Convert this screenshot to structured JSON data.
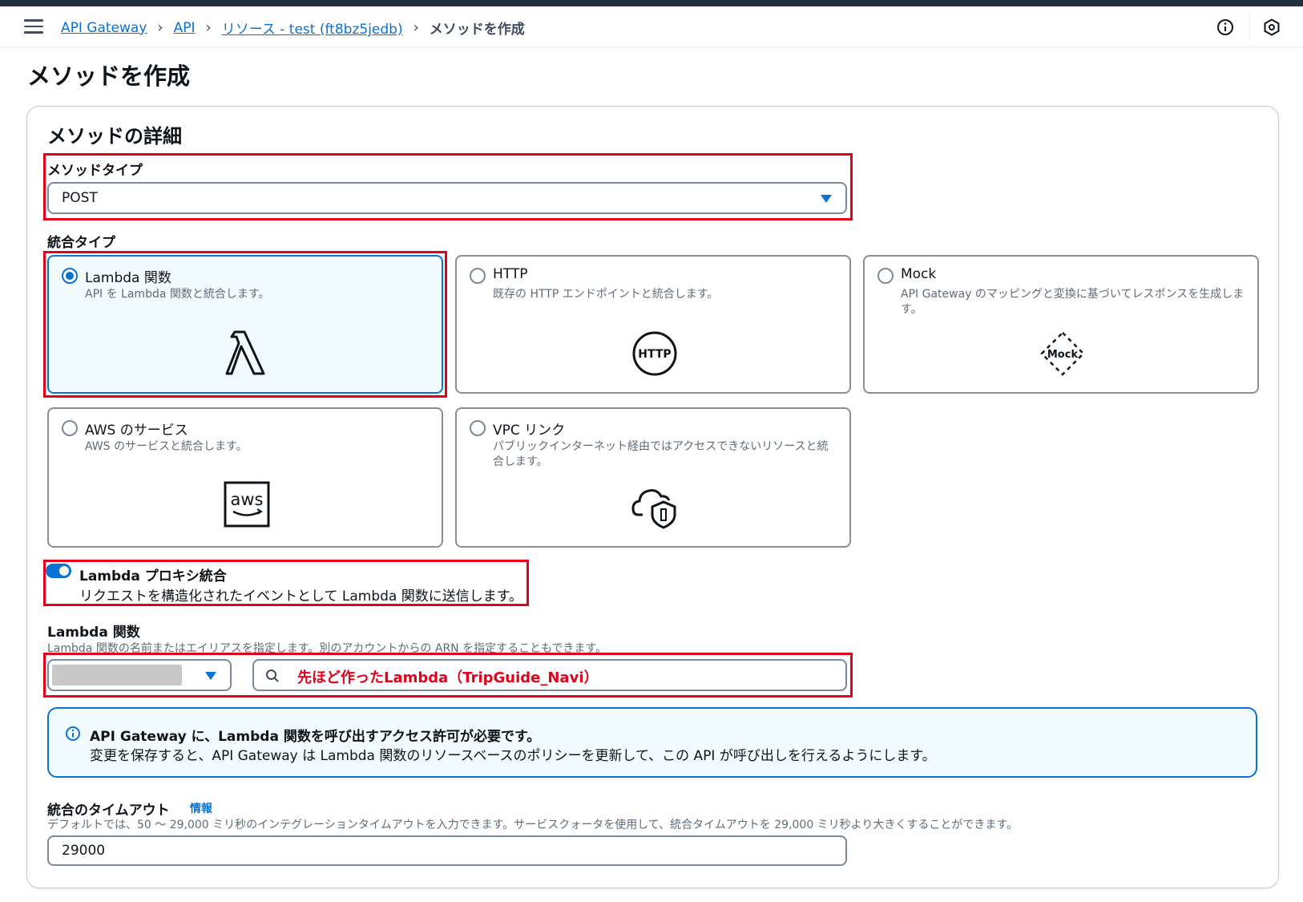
{
  "breadcrumb": {
    "items": [
      "API Gateway",
      "API",
      "リソース - test (ft8bz5jedb)"
    ],
    "current": "メソッドを作成"
  },
  "header": {
    "info_icon": "info-circle-icon",
    "settings_icon": "hexagon-settings-icon"
  },
  "page_title": "メソッドを作成",
  "method_details": {
    "title": "メソッドの詳細",
    "method_type": {
      "label": "メソッドタイプ",
      "value": "POST"
    },
    "integration_type": {
      "label": "統合タイプ",
      "options": [
        {
          "title": "Lambda 関数",
          "desc": "API を Lambda 関数と統合します。",
          "selected": true,
          "icon": "lambda-icon"
        },
        {
          "title": "HTTP",
          "desc": "既存の HTTP エンドポイントと統合します。",
          "selected": false,
          "icon": "http-icon",
          "icon_text": "HTTP"
        },
        {
          "title": "Mock",
          "desc": "API Gateway のマッピングと変換に基づいてレスポンスを生成します。",
          "selected": false,
          "icon": "mock-icon",
          "icon_text": "Mock"
        },
        {
          "title": "AWS のサービス",
          "desc": "AWS のサービスと統合します。",
          "selected": false,
          "icon": "aws-icon",
          "icon_text": "aws"
        },
        {
          "title": "VPC リンク",
          "desc": "パブリックインターネット経由ではアクセスできないリソースと統合します。",
          "selected": false,
          "icon": "cloud-shield-icon"
        }
      ]
    },
    "lambda_proxy": {
      "label": "Lambda プロキシ統合",
      "desc": "リクエストを構造化されたイベントとして Lambda 関数に送信します。",
      "enabled": true
    },
    "lambda_function": {
      "label": "Lambda 関数",
      "desc": "Lambda 関数の名前またはエイリアスを指定します。別のアカウントからの ARN を指定することもできます。",
      "region_value": "",
      "search_value": "先ほど作ったLambda（TripGuide_Navi）",
      "search_value_color": "#e3001b"
    },
    "alert": {
      "title": "API Gateway に、Lambda 関数を呼び出すアクセス許可が必要です。",
      "text": "変更を保存すると、API Gateway は Lambda 関数のリソースベースのポリシーを更新して、この API が呼び出しを行えるようにします。"
    },
    "timeout": {
      "label": "統合のタイムアウト",
      "info_link": "情報",
      "desc": "デフォルトでは、50 ～ 29,000 ミリ秒のインテグレーションタイムアウトを入力できます。サービスクォータを使用して、統合タイムアウトを 29,000 ミリ秒より大きくすることができます。",
      "value": "29000"
    }
  },
  "colors": {
    "accent": "#0972d3",
    "highlight": "#e3001b",
    "selected_bg": "#f2fbfe"
  }
}
